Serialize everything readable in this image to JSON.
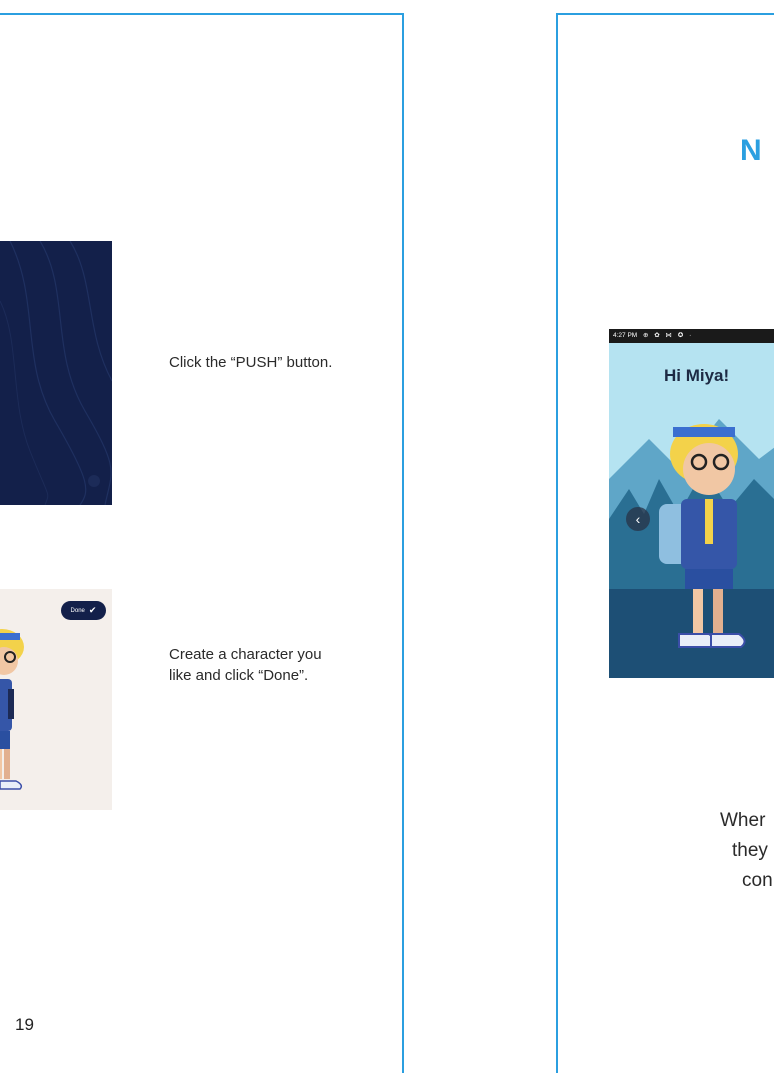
{
  "colors": {
    "accent": "#2b9fe0",
    "navy": "#13204a",
    "text": "#2a2a2a"
  },
  "left_page": {
    "step1": {
      "text": "Click the “PUSH” button."
    },
    "step2": {
      "text": "Create a character you like and click “Done”."
    },
    "creator": {
      "done_label": "Done",
      "done_icon": "check-icon"
    },
    "page_number": "19"
  },
  "right_page": {
    "heading": "N",
    "phone": {
      "status_time": "4:27 PM",
      "greeting": "Hi Miya!",
      "back_icon": "chevron-left-icon"
    },
    "text_lines": [
      "Wher",
      "they",
      "con"
    ]
  }
}
